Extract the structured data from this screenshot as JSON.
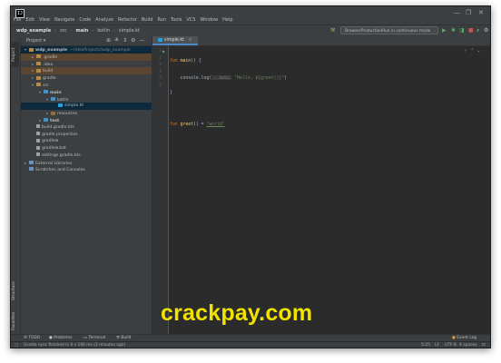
{
  "menu": [
    "File",
    "Edit",
    "View",
    "Navigate",
    "Code",
    "Analyze",
    "Refactor",
    "Build",
    "Run",
    "Tools",
    "VCS",
    "Window",
    "Help"
  ],
  "window_controls": [
    "—",
    "❐",
    "✕"
  ],
  "breadcrumb": [
    "wdp_example",
    "src",
    "main",
    "kotlin",
    "simple.kt"
  ],
  "run_config": "BrowserProductionRun in continuous mode",
  "toolbar_icons": [
    "hammer-icon",
    "run-icon",
    "debug-icon",
    "coverage-icon",
    "stop-icon",
    "search-icon",
    "settings-icon"
  ],
  "left_tabs": [
    "Project",
    "Structure",
    "Favorites"
  ],
  "project_panel": {
    "title": "Project",
    "tree": [
      {
        "label": "wdp_example",
        "hint": "~/IdeaProjects/wdp_example",
        "arrow": "▾",
        "icon": "fold",
        "bold": true,
        "indent": 0,
        "state": "sel"
      },
      {
        "label": ".gradle",
        "arrow": "▸",
        "icon": "fold",
        "indent": 1,
        "state": "hl"
      },
      {
        "label": ".idea",
        "arrow": "▸",
        "icon": "fold",
        "indent": 1,
        "state": ""
      },
      {
        "label": "build",
        "arrow": "▸",
        "icon": "fold",
        "indent": 1,
        "state": "hl"
      },
      {
        "label": "gradle",
        "arrow": "▸",
        "icon": "fold",
        "indent": 1,
        "state": ""
      },
      {
        "label": "src",
        "arrow": "▾",
        "icon": "fold",
        "indent": 1,
        "state": ""
      },
      {
        "label": "main",
        "arrow": "▾",
        "icon": "src",
        "bold": true,
        "indent": 2,
        "state": ""
      },
      {
        "label": "kotlin",
        "arrow": "▾",
        "icon": "src",
        "indent": 3,
        "state": ""
      },
      {
        "label": "simple.kt",
        "arrow": "",
        "icon": "kt",
        "indent": 4,
        "state": "sel"
      },
      {
        "label": "resources",
        "arrow": "▸",
        "icon": "fold2",
        "indent": 3,
        "state": ""
      },
      {
        "label": "test",
        "arrow": "▸",
        "icon": "src",
        "bold": true,
        "indent": 2,
        "state": ""
      },
      {
        "label": "build.gradle.kts",
        "arrow": "",
        "icon": "file",
        "indent": 1,
        "state": ""
      },
      {
        "label": "gradle.properties",
        "arrow": "",
        "icon": "file",
        "indent": 1,
        "state": ""
      },
      {
        "label": "gradlew",
        "arrow": "",
        "icon": "file",
        "indent": 1,
        "state": ""
      },
      {
        "label": "gradlew.bat",
        "arrow": "",
        "icon": "file",
        "indent": 1,
        "state": ""
      },
      {
        "label": "settings.gradle.kts",
        "arrow": "",
        "icon": "file",
        "indent": 1,
        "state": ""
      },
      {
        "label": "External Libraries",
        "arrow": "▸",
        "icon": "lib",
        "indent": 0,
        "state": ""
      },
      {
        "label": "Scratches and Consoles",
        "arrow": "",
        "icon": "lib",
        "indent": 0,
        "state": ""
      }
    ]
  },
  "editor": {
    "tab_label": "simple.kt",
    "line_numbers": [
      "1",
      "2",
      "3",
      "4",
      "5",
      "6"
    ],
    "code": {
      "l1_kw": "fun ",
      "l1_fn": "main",
      "l1_rest": "() {",
      "l2_pre": "    console.log(",
      "l2_hint": "...data:",
      "l2_str": " \"Hello, ${greet()}\"",
      "l2_post": ")",
      "l3": "}",
      "l5_kw": "fun ",
      "l5_fn": "greet",
      "l5_mid": "() = ",
      "l5_str": "\"world\""
    },
    "right_icons": [
      "✓",
      "⌃",
      "⌄"
    ]
  },
  "bottom_tabs": [
    "TODO",
    "Problems",
    "Terminal",
    "Build"
  ],
  "event_log": "Event Log",
  "status": {
    "message": "Gradle sync finished in 6 s 140 ms (3 minutes ago)",
    "position": "5:25",
    "line_sep": "LF",
    "encoding": "UTF-8",
    "indent": "4 spaces"
  },
  "watermark": "crackpay.com"
}
